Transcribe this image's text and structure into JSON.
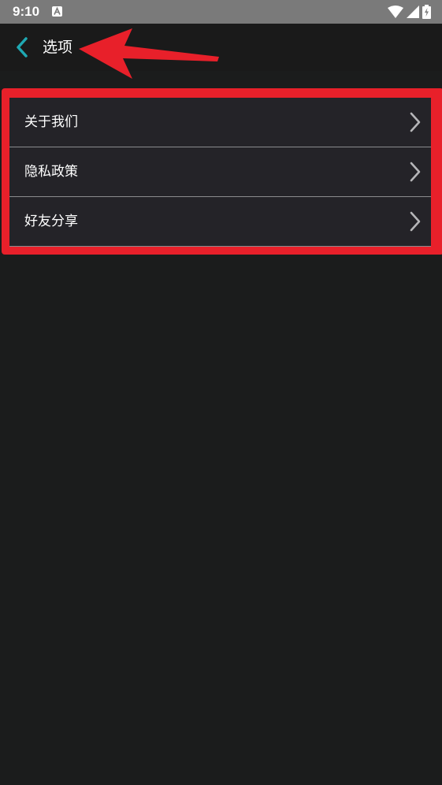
{
  "status_bar": {
    "time": "9:10",
    "icons": [
      "a-notification-icon",
      "wifi-icon",
      "signal-icon",
      "battery-charging-icon"
    ]
  },
  "toolbar": {
    "back_icon": "chevron-left-icon",
    "title": "选项"
  },
  "colors": {
    "accent": "#1fa8b2",
    "background": "#1b1c1c",
    "list_background": "#242328",
    "annotation": "#e8202a"
  },
  "menu": {
    "items": [
      {
        "label": "关于我们",
        "icon": "chevron-right-icon"
      },
      {
        "label": "隐私政策",
        "icon": "chevron-right-icon"
      },
      {
        "label": "好友分享",
        "icon": "chevron-right-icon"
      }
    ]
  }
}
